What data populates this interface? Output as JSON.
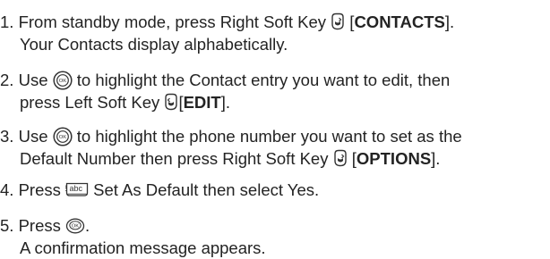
{
  "steps": [
    {
      "number": "1.",
      "line1_pre": "From standby mode, press Right Soft Key",
      "line1_bracket_open": "[",
      "line1_bold": "CONTACTS",
      "line1_bracket_close": "].",
      "line2": "Your Contacts display alphabetically.",
      "icon": "right-soft-key-icon"
    },
    {
      "number": "2.",
      "line1_pre": "Use",
      "line1_post": "to highlight the Contact entry you want to edit, then",
      "line2_pre": "press Left Soft Key",
      "line2_bracket_open": "[",
      "line2_bold": "EDIT",
      "line2_bracket_close": "].",
      "icons": [
        "ok-nav-key-icon",
        "left-soft-key-icon"
      ]
    },
    {
      "number": "3.",
      "line1_pre": "Use",
      "line1_post": "to highlight the phone number you want to set as the",
      "line2_pre": "Default Number then press Right Soft Key",
      "line2_bracket_open": "[",
      "line2_bold": "OPTIONS",
      "line2_bracket_close": "].",
      "icons": [
        "ok-nav-key-icon",
        "right-soft-key-icon"
      ]
    },
    {
      "number": "4.",
      "line1_pre": "Press",
      "line1_post": "Set As Default then select Yes.",
      "icon": "key-2-abc-icon",
      "icon_label": "2 abc"
    },
    {
      "number": "5.",
      "line1_pre": "Press",
      "line1_post": ".",
      "line2": "A confirmation message appears.",
      "icon": "ok-key-icon",
      "icon_label": "OK"
    }
  ]
}
